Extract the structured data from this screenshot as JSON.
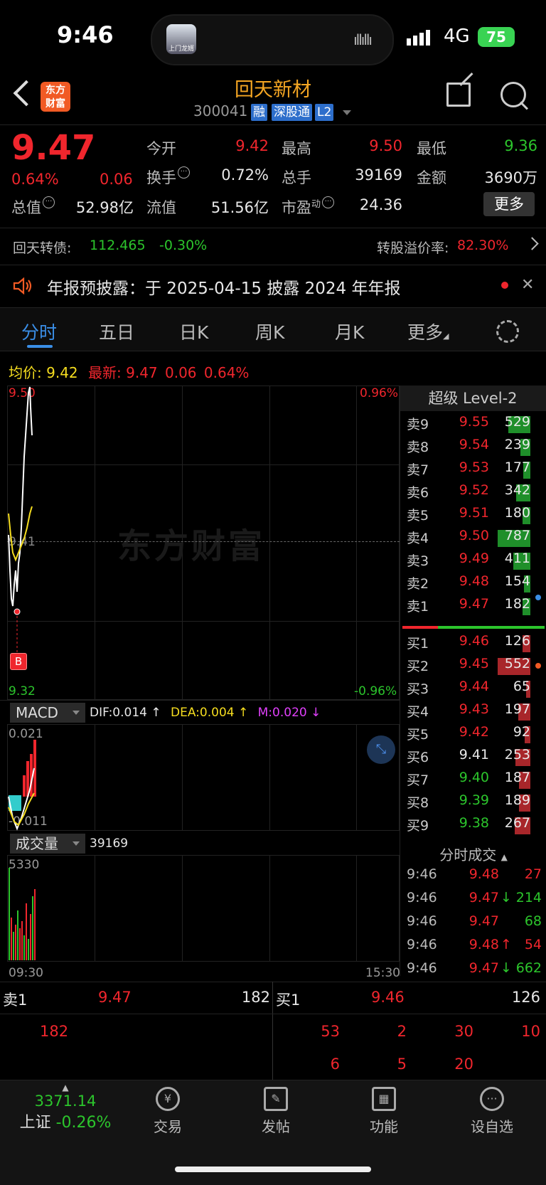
{
  "status_bar": {
    "time": "9:46",
    "network": "4G",
    "battery": "75",
    "island_thumb_text": "上门龙婿"
  },
  "header": {
    "logo": "东方\n财富",
    "name": "回天新材",
    "code": "300041",
    "tags": [
      "融",
      "深股通",
      "L2"
    ]
  },
  "quote": {
    "price": "9.47",
    "change_pct": "0.64%",
    "change": "0.06",
    "open_label": "今开",
    "open": "9.42",
    "high_label": "最高",
    "high": "9.50",
    "low_label": "最低",
    "low": "9.36",
    "turnover_label": "换手",
    "turnover": "0.72%",
    "volume_label": "总手",
    "volume": "39169",
    "amount_label": "金额",
    "amount": "3690万",
    "mktcap_label": "总值",
    "mktcap": "52.98亿",
    "float_label": "流值",
    "float": "51.56亿",
    "pe_label": "市盈",
    "pe_sup": "动",
    "pe": "24.36",
    "more": "更多"
  },
  "bond": {
    "label": "回天转债:",
    "price": "112.465",
    "pct": "-0.30%",
    "premium_label": "转股溢价率:",
    "premium": "82.30%"
  },
  "announcement": {
    "text": "年报预披露：于 2025-04-15 披露 2024 年年报"
  },
  "tabs": [
    "分时",
    "五日",
    "日K",
    "周K",
    "月K",
    "更多"
  ],
  "intraday": {
    "avg_label": "均价:",
    "avg": "9.42",
    "last_label": "最新:",
    "last": "9.47",
    "chg": "0.06",
    "pct": "0.64%",
    "y_top": "9.50",
    "y_bottom": "9.32",
    "pct_top": "0.96%",
    "pct_bottom": "-0.96%",
    "mid_label": "9.41",
    "watermark": "东方财富",
    "b_marker": "B",
    "x_start": "09:30",
    "x_end": "15:30"
  },
  "macd": {
    "label": "MACD",
    "dif": "DIF:0.014 ↑",
    "dea": "DEA:0.004 ↑",
    "m": "M:0.020 ↓",
    "top": "0.021",
    "bottom": "-0.011"
  },
  "volume": {
    "label": "成交量",
    "value": "39169",
    "top": "5330"
  },
  "level2": {
    "title": "超级 Level-2",
    "asks": [
      {
        "label": "卖9",
        "price": "9.55",
        "vol": "529",
        "color": "red",
        "bar": 0.67
      },
      {
        "label": "卖8",
        "price": "9.54",
        "vol": "239",
        "color": "red",
        "bar": 0.3
      },
      {
        "label": "卖7",
        "price": "9.53",
        "vol": "177",
        "color": "red",
        "bar": 0.22
      },
      {
        "label": "卖6",
        "price": "9.52",
        "vol": "342",
        "color": "red",
        "bar": 0.43
      },
      {
        "label": "卖5",
        "price": "9.51",
        "vol": "180",
        "color": "red",
        "bar": 0.23
      },
      {
        "label": "卖4",
        "price": "9.50",
        "vol": "787",
        "color": "red",
        "bar": 1.0
      },
      {
        "label": "卖3",
        "price": "9.49",
        "vol": "411",
        "color": "red",
        "bar": 0.52
      },
      {
        "label": "卖2",
        "price": "9.48",
        "vol": "154",
        "color": "red",
        "bar": 0.2
      },
      {
        "label": "卖1",
        "price": "9.47",
        "vol": "182",
        "color": "red",
        "bar": 0.23
      }
    ],
    "bids": [
      {
        "label": "买1",
        "price": "9.46",
        "vol": "126",
        "color": "red",
        "bar": 0.23
      },
      {
        "label": "买2",
        "price": "9.45",
        "vol": "552",
        "color": "red",
        "bar": 1.0
      },
      {
        "label": "买3",
        "price": "9.44",
        "vol": "65",
        "color": "red",
        "bar": 0.12
      },
      {
        "label": "买4",
        "price": "9.43",
        "vol": "197",
        "color": "red",
        "bar": 0.36
      },
      {
        "label": "买5",
        "price": "9.42",
        "vol": "92",
        "color": "red",
        "bar": 0.17
      },
      {
        "label": "买6",
        "price": "9.41",
        "vol": "253",
        "color": "white",
        "bar": 0.46
      },
      {
        "label": "买7",
        "price": "9.40",
        "vol": "187",
        "color": "green",
        "bar": 0.34
      },
      {
        "label": "买8",
        "price": "9.39",
        "vol": "189",
        "color": "green",
        "bar": 0.34
      },
      {
        "label": "买9",
        "price": "9.38",
        "vol": "267",
        "color": "green",
        "bar": 0.48
      }
    ],
    "trades_title": "分时成交",
    "trades": [
      {
        "time": "9:46",
        "price": "9.48",
        "arrow": "",
        "vol": "27",
        "vcolor": "red"
      },
      {
        "time": "9:46",
        "price": "9.47",
        "arrow": "↓",
        "vol": "214",
        "vcolor": "green"
      },
      {
        "time": "9:46",
        "price": "9.47",
        "arrow": "",
        "vol": "68",
        "vcolor": "green"
      },
      {
        "time": "9:46",
        "price": "9.48",
        "arrow": "↑",
        "vol": "54",
        "vcolor": "red"
      },
      {
        "time": "9:46",
        "price": "9.47",
        "arrow": "↓",
        "vol": "662",
        "vcolor": "green"
      }
    ]
  },
  "depth": {
    "ask1_label": "卖1",
    "ask1_price": "9.47",
    "ask1_vol": "182",
    "bid1_label": "买1",
    "bid1_price": "9.46",
    "bid1_vol": "126",
    "ask_orders": [
      "182"
    ],
    "bid_orders_row1": [
      "53",
      "2",
      "30",
      "10"
    ],
    "bid_orders_row2": [
      "6",
      "5",
      "20"
    ]
  },
  "tabbar": {
    "index_value": "3371.14",
    "index_name": "上证",
    "index_pct": "-0.26%",
    "items": [
      "交易",
      "发帖",
      "功能",
      "设自选"
    ]
  }
}
